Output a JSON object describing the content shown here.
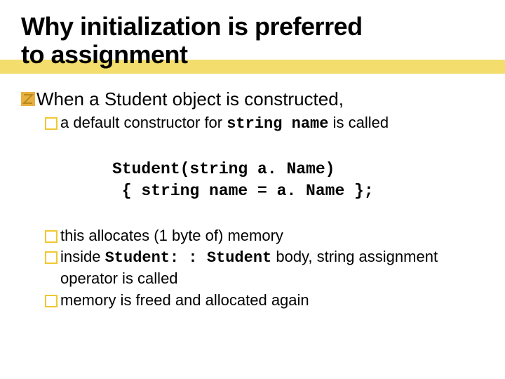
{
  "title_line1": "Why initialization is preferred",
  "title_line2": "to assignment",
  "p1": "When a Student object is constructed,",
  "p1a_pre": "a default constructor for ",
  "p1a_mono": "string name",
  "p1a_post": " is called",
  "code_line1": "Student(string a. Name)",
  "code_line2": " { string name = a. Name };",
  "p2": "this allocates (1 byte of) memory",
  "p3_pre": "inside ",
  "p3_mono": "Student: : Student",
  "p3_post": " body, string assignment operator is called",
  "p4": "memory is freed and allocated again"
}
